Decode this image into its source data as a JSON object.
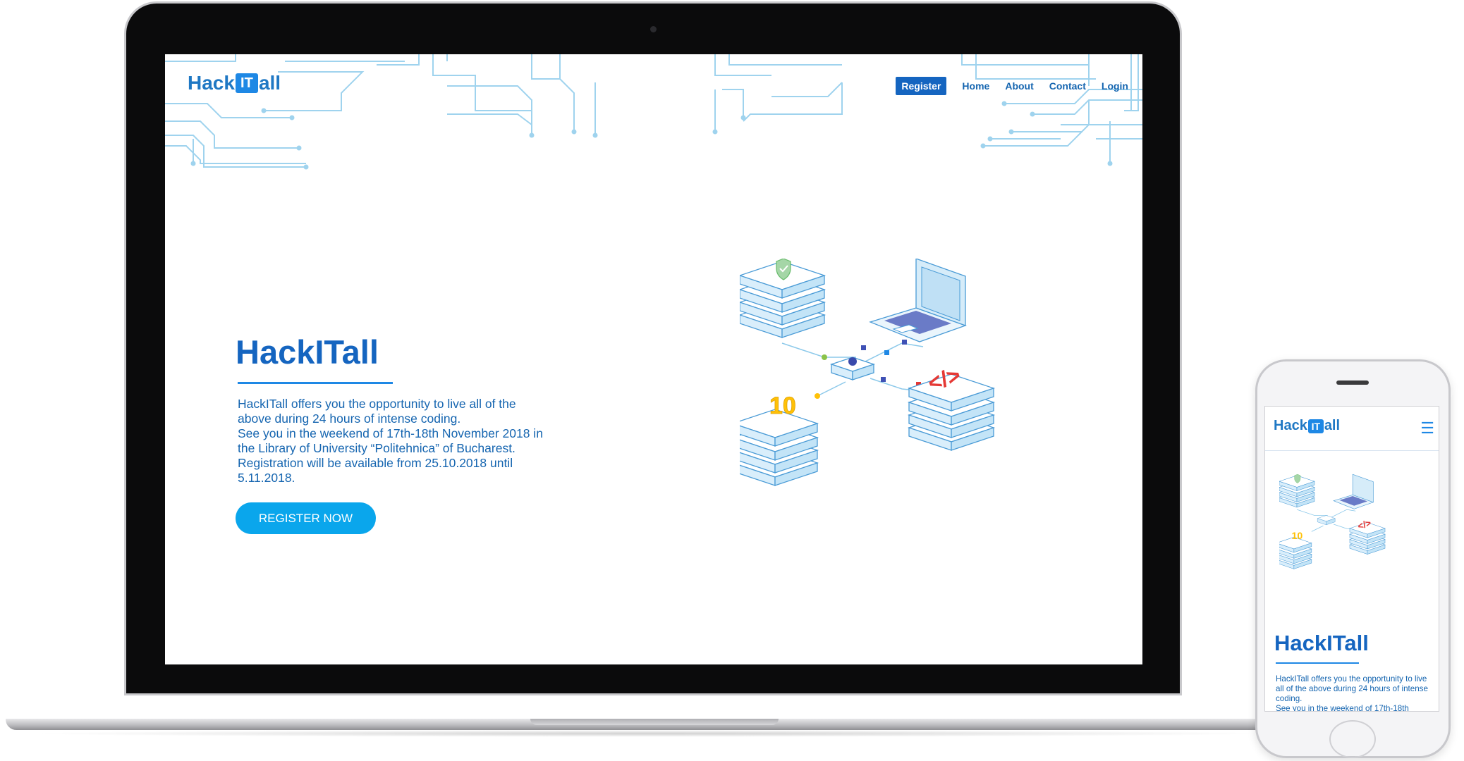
{
  "brand": {
    "logo_left": "Hack",
    "logo_mid": "IT",
    "logo_right": "all"
  },
  "nav": {
    "register": "Register",
    "home": "Home",
    "about": "About",
    "contact": "Contact",
    "login": "Login"
  },
  "hero": {
    "title": "HackITall",
    "line1": "HackITall offers you the opportunity to live all of the above during 24 hours of intense coding.",
    "line2": "See you in the weekend of 17th-18th November 2018 in the Library of University “Politehnica” of Bucharest.",
    "line3": "Registration will be available from 25.10.2018 until 5.11.2018.",
    "cta": "REGISTER NOW"
  },
  "illustration": {
    "score_badge": "10",
    "code_badge": "</>"
  },
  "mobile": {
    "title": "HackITall",
    "line1": "HackITall offers you the opportunity to live all of the above during 24 hours of intense coding.",
    "line2": "See you in the weekend of 17th-18th",
    "menu_icon": "hamburger-icon"
  },
  "colors": {
    "brand_blue": "#1565c0",
    "accent_blue": "#0aa6ec",
    "circuit": "#9fd3ee"
  }
}
